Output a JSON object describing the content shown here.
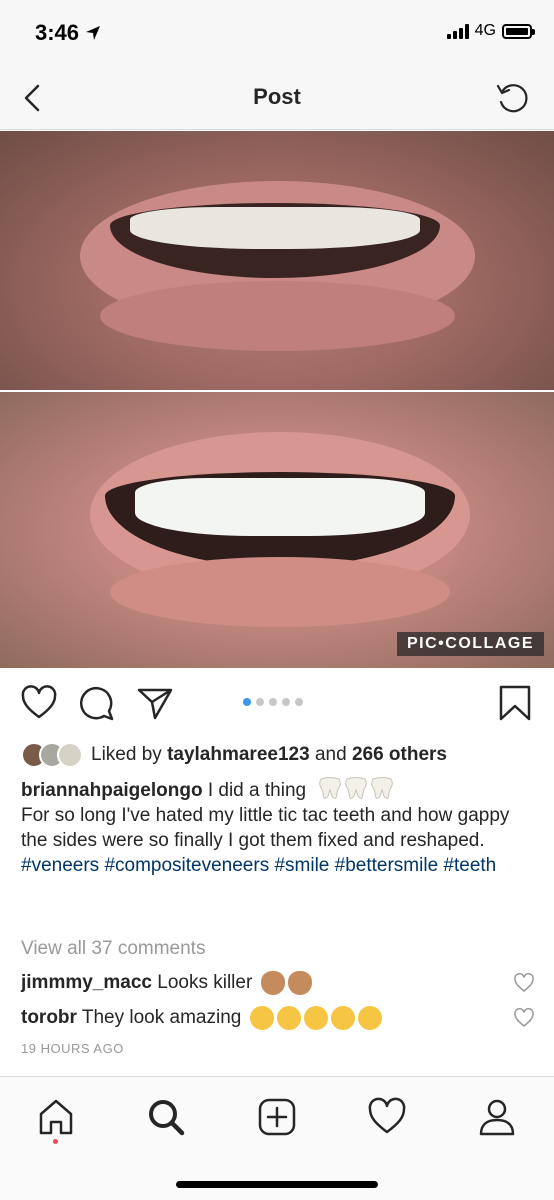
{
  "status_bar": {
    "time": "3:46",
    "network": "4G"
  },
  "nav": {
    "title": "Post"
  },
  "photo": {
    "watermark": "PIC•COLLAGE",
    "carousel_count": 5,
    "carousel_active": 1
  },
  "likes": {
    "prefix": "Liked by ",
    "user": "taylahmaree123",
    "middle": " and ",
    "others": "266 others"
  },
  "caption": {
    "username": "briannahpaigelongo",
    "line1": " I did a thing ",
    "body": "For so long I've hated my little tic tac teeth and how gappy the sides were so finally I got them fixed and reshaped.",
    "hashtags": "#veneers #compositeveneers #smile #bettersmile #teeth"
  },
  "view_all": "View all 37 comments",
  "comments": [
    {
      "user": "jimmmy_macc",
      "text": " Looks killer "
    },
    {
      "user": "torobr",
      "text": " They look amazing "
    }
  ],
  "timestamp": "19 HOURS AGO",
  "colors": {
    "link": "#003569",
    "accent": "#3897f0",
    "notification": "#ed4956"
  }
}
